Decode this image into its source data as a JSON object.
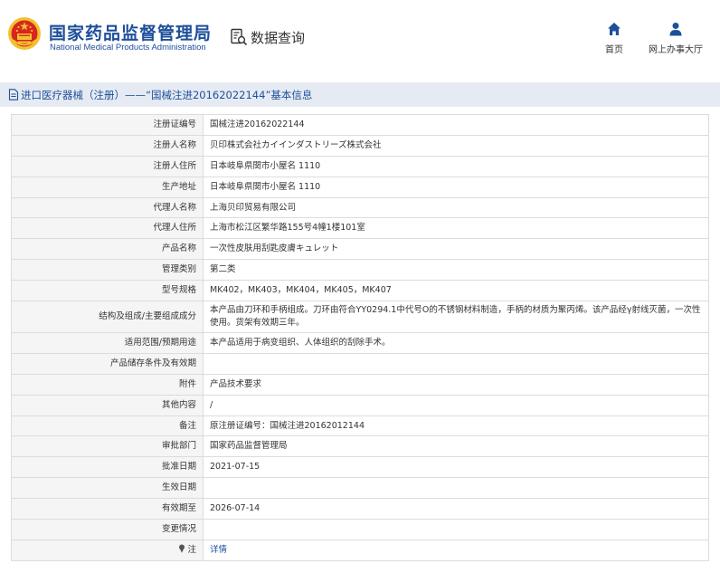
{
  "header": {
    "title": "国家药品监督管理局",
    "subtitle": "National Medical Products Administration",
    "query_label": "数据查询",
    "nav": [
      {
        "label": "首页",
        "icon": "home-icon"
      },
      {
        "label": "网上办事大厅",
        "icon": "person-icon"
      }
    ]
  },
  "section": {
    "title": "进口医疗器械（注册）——“国械注进20162022144”基本信息"
  },
  "rows": [
    {
      "key": "注册证编号",
      "value": "国械注进20162022144"
    },
    {
      "key": "注册人名称",
      "value": "贝印株式会社カイインダストリーズ株式会社"
    },
    {
      "key": "注册人住所",
      "value": "日本岐阜県関市小屋名 1110"
    },
    {
      "key": "生产地址",
      "value": "日本岐阜県関市小屋名 1110"
    },
    {
      "key": "代理人名称",
      "value": "上海贝印贸易有限公司"
    },
    {
      "key": "代理人住所",
      "value": "上海市松江区繁华路155号4幢1楼101室"
    },
    {
      "key": "产品名称",
      "value": "一次性皮肤用刮匙皮膚キュレット"
    },
    {
      "key": "管理类别",
      "value": "第二类"
    },
    {
      "key": "型号规格",
      "value": "MK402，MK403，MK404，MK405，MK407"
    },
    {
      "key": "结构及组成/主要组成成分",
      "value": "本产品由刀环和手柄组成。刀环由符合YY0294.1中代号O的不锈钢材料制造，手柄的材质为聚丙烯。该产品经γ射线灭菌，一次性使用。货架有效期三年。"
    },
    {
      "key": "适用范围/预期用途",
      "value": "本产品适用于病变组织、人体组织的刮除手术。"
    },
    {
      "key": "产品储存条件及有效期",
      "value": ""
    },
    {
      "key": "附件",
      "value": "产品技术要求"
    },
    {
      "key": "其他内容",
      "value": "/"
    },
    {
      "key": "备注",
      "value": "原注册证编号：国械注进20162012144"
    },
    {
      "key": "审批部门",
      "value": "国家药品监督管理局"
    },
    {
      "key": "批准日期",
      "value": "2021-07-15"
    },
    {
      "key": "生效日期",
      "value": ""
    },
    {
      "key": "有效期至",
      "value": "2026-07-14"
    },
    {
      "key": "变更情况",
      "value": ""
    },
    {
      "key": "注",
      "value": "详情"
    }
  ],
  "colors": {
    "brand_blue": "#1d4f9a",
    "section_bg": "#e6ebf3",
    "key_cell_bg": "#f5f5f5",
    "border": "#dcdcdc",
    "emblem_red": "#d7261e",
    "emblem_gold": "#f2c230"
  }
}
